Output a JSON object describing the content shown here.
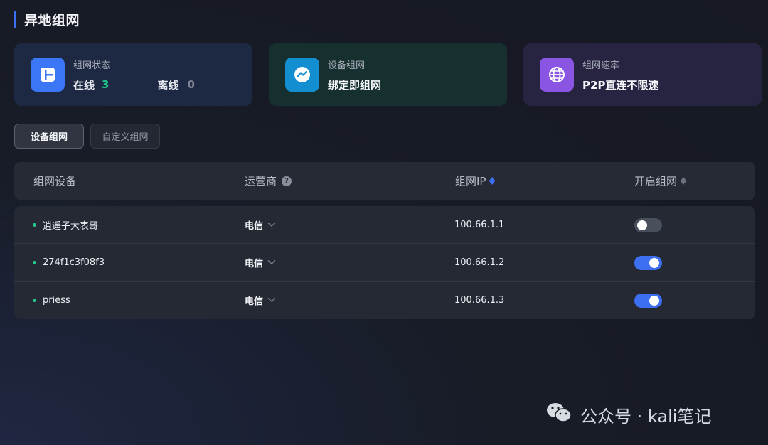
{
  "page": {
    "title": "异地组网"
  },
  "cards": [
    {
      "label": "组网状态",
      "online_label": "在线",
      "online_count": "3",
      "offline_label": "离线",
      "offline_count": "0",
      "icon": "layout-icon"
    },
    {
      "label": "设备组网",
      "value": "绑定即组网",
      "icon": "chat-bubble-icon"
    },
    {
      "label": "组网速率",
      "value": "P2P直连不限速",
      "icon": "globe-icon"
    }
  ],
  "tabs": [
    {
      "label": "设备组网",
      "active": true
    },
    {
      "label": "自定义组网",
      "active": false
    }
  ],
  "table": {
    "headers": {
      "device": "组网设备",
      "isp": "运营商",
      "ip": "组网IP",
      "enable": "开启组网"
    },
    "rows": [
      {
        "device": "逍遥子大表哥",
        "isp": "电信",
        "ip": "100.66.1.1",
        "enabled": false
      },
      {
        "device": "274f1c3f08f3",
        "isp": "电信",
        "ip": "100.66.1.2",
        "enabled": true
      },
      {
        "device": "priess",
        "isp": "电信",
        "ip": "100.66.1.3",
        "enabled": true
      }
    ]
  },
  "watermark": {
    "text": "公众号 · kali笔记",
    "icon": "wechat-icon"
  },
  "colors": {
    "accent": "#3d6ff3",
    "online": "#1fc78a"
  }
}
